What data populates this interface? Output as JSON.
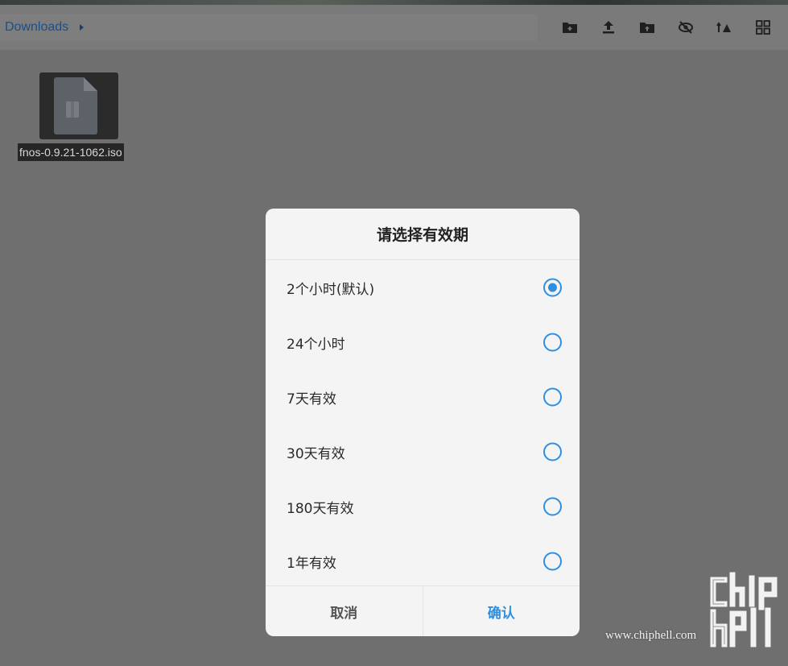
{
  "breadcrumb": {
    "current": "Downloads"
  },
  "toolbar": {
    "icons": [
      "new-folder-icon",
      "upload-icon",
      "upload-folder-icon",
      "hide-icon",
      "sort-icon",
      "grid-view-icon"
    ]
  },
  "files": [
    {
      "name": "fnos-0.9.21-1062.iso"
    }
  ],
  "dialog": {
    "title": "请选择有效期",
    "options": [
      {
        "label": "2个小时(默认)",
        "checked": true
      },
      {
        "label": "24个小时",
        "checked": false
      },
      {
        "label": "7天有效",
        "checked": false
      },
      {
        "label": "30天有效",
        "checked": false
      },
      {
        "label": "180天有效",
        "checked": false
      },
      {
        "label": "1年有效",
        "checked": false
      }
    ],
    "cancel_label": "取消",
    "confirm_label": "确认"
  },
  "watermark": {
    "url": "www.chiphell.com",
    "logo_text": "chip hell"
  },
  "colors": {
    "accent": "#2e8fe0",
    "overlay": "#6f6f6f",
    "dialog_bg": "#f4f4f4"
  }
}
